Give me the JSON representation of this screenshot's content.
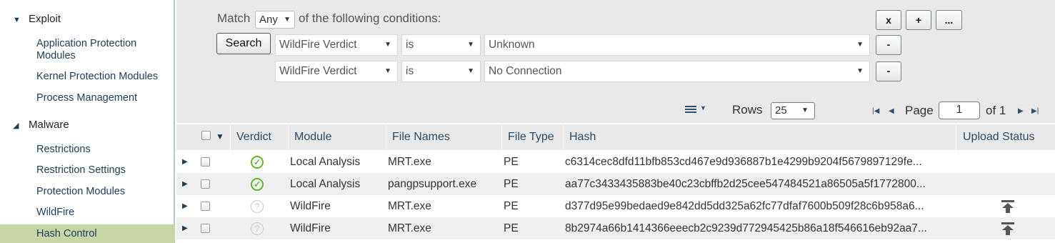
{
  "sidebar": {
    "groups": [
      {
        "label": "Exploit",
        "icon": "triangle-down-icon",
        "items": [
          "Application Protection Modules",
          "Kernel Protection Modules",
          "Process Management"
        ]
      },
      {
        "label": "Malware",
        "icon": "triangle-expanded-icon",
        "items": [
          "Restrictions",
          "Restriction Settings",
          "Protection Modules",
          "WildFire",
          "Hash Control"
        ]
      }
    ],
    "active_item": "Hash Control"
  },
  "filter": {
    "match_prefix": "Match",
    "match_value": "Any",
    "match_suffix": "of the following conditions:",
    "search_label": "Search",
    "remove_all_label": "x",
    "add_label": "+",
    "more_label": "...",
    "conditions": [
      {
        "field": "WildFire Verdict",
        "operator": "is",
        "value": "Unknown",
        "remove_label": "-"
      },
      {
        "field": "WildFire Verdict",
        "operator": "is",
        "value": "No Connection",
        "remove_label": "-"
      }
    ]
  },
  "toolbar": {
    "menu_icon": "list-menu-icon",
    "rows_label": "Rows",
    "rows_value": "25",
    "page_label": "Page",
    "page_value": "1",
    "of_label": "of 1"
  },
  "table": {
    "columns": [
      "Verdict",
      "Module",
      "File Names",
      "File Type",
      "Hash",
      "Upload Status"
    ],
    "rows": [
      {
        "verdict": "benign",
        "module": "Local Analysis",
        "file_name": "MRT.exe",
        "file_type": "PE",
        "hash": "c6314cec8dfd11bfb853cd467e9d936887b1e4299b9204f5679897129fe...",
        "upload": false
      },
      {
        "verdict": "benign",
        "module": "Local Analysis",
        "file_name": "pangpsupport.exe",
        "file_type": "PE",
        "hash": "aa77c3433435883be40c23cbffb2d25cee547484521a86505a5f1772800...",
        "upload": false
      },
      {
        "verdict": "unknown",
        "module": "WildFire",
        "file_name": "MRT.exe",
        "file_type": "PE",
        "hash": "d377d95e99bedaed9e842dd5dd325a62fc77dfaf7600b509f28c6b958a6...",
        "upload": true
      },
      {
        "verdict": "unknown",
        "module": "WildFire",
        "file_name": "MRT.exe",
        "file_type": "PE",
        "hash": "8b2974a66b1414366eeecb2c9239d772945425b86a18f546616eb92aa7...",
        "upload": true
      }
    ]
  },
  "colors": {
    "active_bg": "#c8d6a5",
    "benign": "#5cb82e",
    "header_text": "#2b4a66"
  }
}
